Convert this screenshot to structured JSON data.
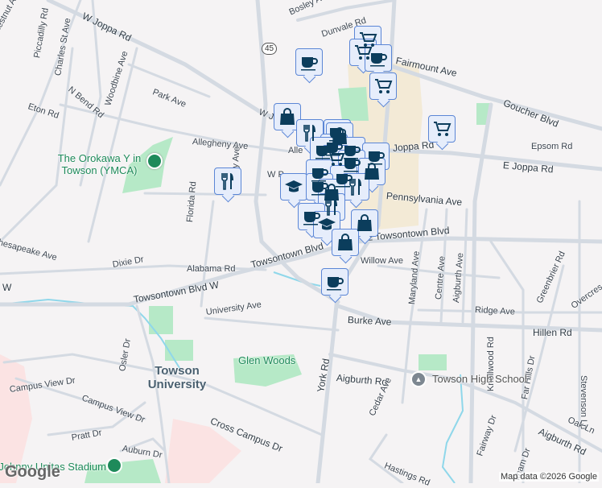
{
  "map": {
    "streets": {
      "w_joppa_rd": "W Joppa Rd",
      "chestnut_ave": "Chestnut Ave",
      "piccadilly_rd": "Piccadilly Rd",
      "charles_st_ave": "Charles St Ave",
      "n_bend_rd": "N Bend Rd",
      "woodbine_ave": "Woodbine Ave",
      "park_ave": "Park Ave",
      "eton_rd": "Eton Rd",
      "allegheny_ave": "Allegheny Ave",
      "allegheny_ave_2": "Alle",
      "w_j": "W J",
      "w_p": "W P",
      "bosley_ave": "Bosley Ave",
      "bosley_ave_top": "Bosley Ave",
      "dunvale_rd": "Dunvale Rd",
      "fairmount_ave": "Fairmount Ave",
      "goucher_blvd": "Goucher Blvd",
      "e_joppa_rd": "E Joppa Rd",
      "joppa_rd": "Joppa Rd",
      "epsom_rd": "Epsom Rd",
      "pennsylvania_ave": "Pennsylvania Ave",
      "e_towsontown_blvd": "E Towsontown Blvd",
      "towsontown_blvd": "Towsontown Blvd",
      "towsontown_blvd_w": "Towsontown Blvd W",
      "florida_rd": "Florida Rd",
      "chesapeake_ave": "hesapeake Ave",
      "dixie_dr": "Dixie Dr",
      "alabama_rd": "Alabama Rd",
      "w": "W",
      "willow_ave": "Willow Ave",
      "maryland_ave": "Maryland Ave",
      "centre_ave": "Centre Ave",
      "aigburth_ave": "Aigburth Ave",
      "ridge_ave": "Ridge Ave",
      "greenbrier_rd": "Greenbrier Rd",
      "overcrest": "Overcres",
      "burke_ave": "Burke Ave",
      "hillen_rd": "Hillen Rd",
      "university_ave": "University Ave",
      "osler_dr": "Osler Dr",
      "knollwood_rd": "Knollwood Rd",
      "far_hills_dr": "Far Hills Dr",
      "stevenson_ln": "Stevenson Ln",
      "york_rd": "York Rd",
      "aigburth_rd": "Aigburth Rd",
      "aigburth_rd_2": "Aigburth Rd",
      "cedar_ave": "Cedar Ave",
      "fairway_dr": "Fairway Dr",
      "oak_ln": "Oak Ln",
      "campus_view_dr": "Campus View Dr",
      "campus_view_dr_2": "Campus View Dr",
      "cross_campus_dr": "Cross Campus Dr",
      "pratt_dr": "Pratt Dr",
      "auburn_dr": "Auburn Dr",
      "hastings_rd": "Hastings Rd",
      "markham_dr": "kham Dr"
    },
    "route_shield": "45",
    "places": {
      "ymca": "The Orokawa Y in Towson (YMCA)",
      "glen_woods": "Glen Woods",
      "towson_university": "Towson University",
      "towson_high_school": "Towson High School",
      "stadium": "Johnny Unitas Stadium"
    },
    "attribution": "Map data ©2026 Google",
    "logo": "Google",
    "colors": {
      "marker_icon": "#0b3d5c",
      "marker_bg": "#e6edfb",
      "park": "#b6e9c7",
      "commercial": "#f3ead6"
    }
  }
}
